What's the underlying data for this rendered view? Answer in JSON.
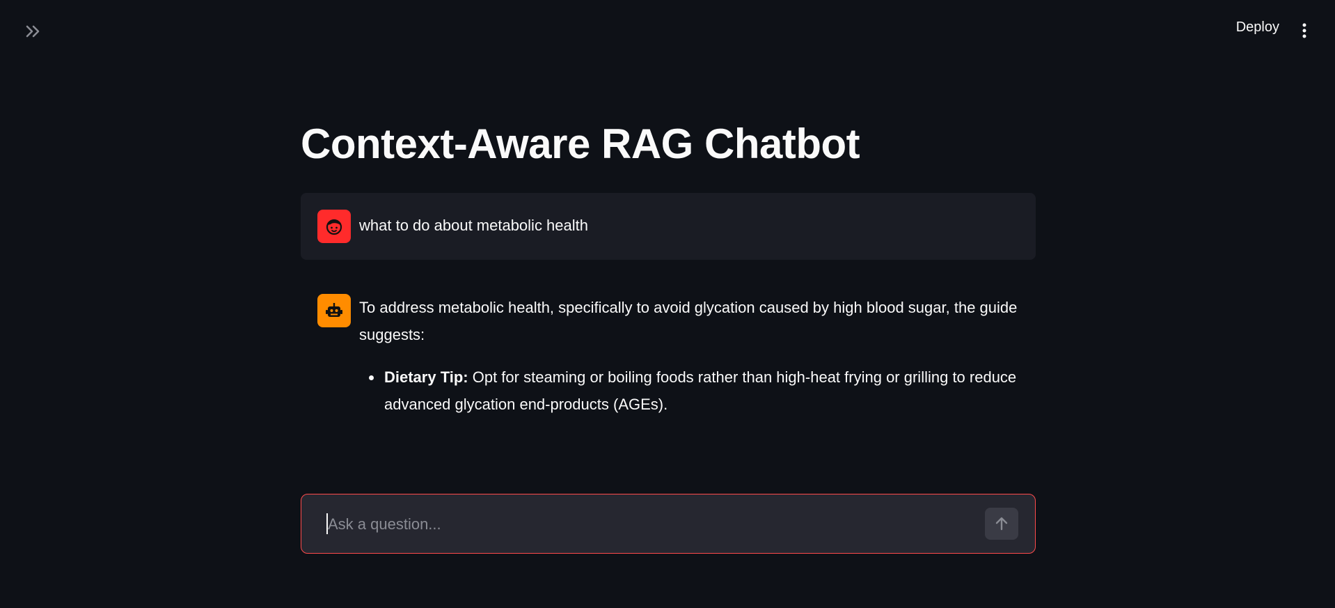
{
  "header": {
    "expand_icon": "double-chevron-right-icon",
    "deploy_label": "Deploy",
    "menu_icon": "vertical-ellipsis-icon"
  },
  "main": {
    "title": "Context-Aware RAG Chatbot"
  },
  "messages": [
    {
      "role": "user",
      "avatar_icon": "user-face-icon",
      "avatar_color": "#ff2b2b",
      "text": "what to do about metabolic health"
    },
    {
      "role": "assistant",
      "avatar_icon": "robot-icon",
      "avatar_color": "#ff8c00",
      "text": "To address metabolic health, specifically to avoid glycation caused by high blood sugar, the guide suggests:",
      "bullets": [
        {
          "label": "Dietary Tip:",
          "text": " Opt for steaming or boiling foods rather than high-heat frying or grilling to reduce advanced glycation end-products (AGEs)."
        }
      ]
    }
  ],
  "chat_input": {
    "placeholder": "Ask a question...",
    "value": "",
    "send_icon": "arrow-up-icon",
    "border_color": "#ff4b4b"
  },
  "colors": {
    "background": "#0e1117",
    "user_message_bg": "#1a1c24",
    "input_bg": "#262730"
  }
}
